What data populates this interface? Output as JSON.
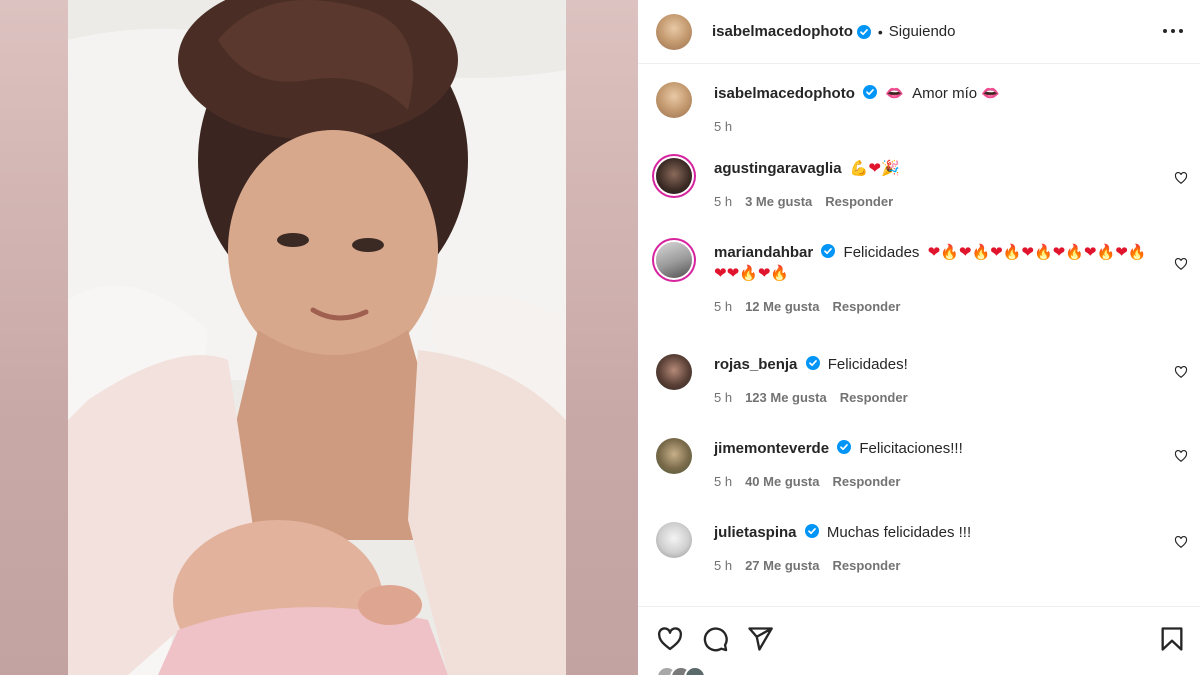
{
  "header": {
    "username": "isabelmacedophoto",
    "separator": "•",
    "follow_state": "Siguiendo",
    "more_icon": "more-horizontal-icon"
  },
  "caption": {
    "username": "isabelmacedophoto",
    "text": "Amor mío",
    "time": "5 h"
  },
  "comments": [
    {
      "username": "agustingaravaglia",
      "verified": false,
      "text": "",
      "time": "5 h",
      "likes": "3 Me gusta",
      "reply": "Responder"
    },
    {
      "username": "mariandahbar",
      "verified": true,
      "text": "Felicidades",
      "time": "5 h",
      "likes": "12 Me gusta",
      "reply": "Responder"
    },
    {
      "username": "rojas_benja",
      "verified": true,
      "text": "Felicidades!",
      "time": "5 h",
      "likes": "123 Me gusta",
      "reply": "Responder"
    },
    {
      "username": "jimemonteverde",
      "verified": true,
      "text": "Felicitaciones!!!",
      "time": "5 h",
      "likes": "40 Me gusta",
      "reply": "Responder"
    },
    {
      "username": "julietaspina",
      "verified": true,
      "text": "Muchas felicidades !!!",
      "time": "5 h",
      "likes": "27 Me gusta",
      "reply": "Responder"
    }
  ],
  "actions": {
    "like_icon": "heart-icon",
    "comment_icon": "comment-icon",
    "share_icon": "send-icon",
    "save_icon": "bookmark-icon"
  },
  "colors": {
    "text": "#262626",
    "secondary": "#737373",
    "verified": "#0095f6",
    "story_ring": "#d6249f",
    "divider": "#efefef"
  }
}
